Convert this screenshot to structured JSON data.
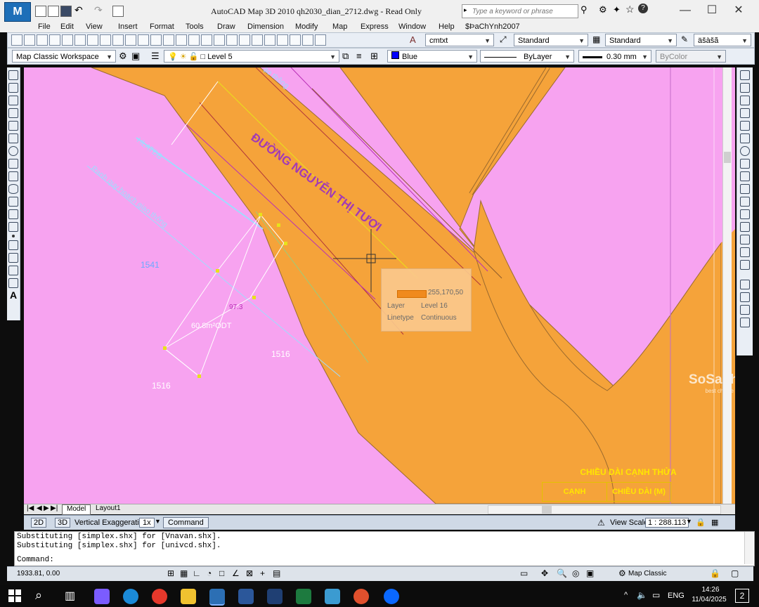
{
  "app": {
    "title": "AutoCAD Map 3D 2010       qh2030_dian_2712.dwg - Read Only",
    "search_placeholder": "Type a keyword or phrase",
    "logo_text": "M",
    "window_controls": [
      "—",
      "☐",
      "✕"
    ]
  },
  "menu": {
    "items": [
      "File",
      "Edit",
      "View",
      "Insert",
      "Format",
      "Tools",
      "Draw",
      "Dimension",
      "Modify",
      "Map",
      "Express",
      "Window",
      "Help",
      "$ÞaChYnh2007"
    ]
  },
  "toolbar2": {
    "text_style": "cmtxt",
    "dim_style": "Standard",
    "table_style": "Standard",
    "extra": "äšàšã"
  },
  "toolbar3": {
    "workspace": "Map Classic Workspace",
    "layer": "Level 5",
    "color": "Blue",
    "linetype": "ByLayer",
    "lineweight": "0.30 mm",
    "plotstyle": "ByColor"
  },
  "drawing": {
    "road_name": "ĐƯỜNG NGUYỄN THỊ TƯƠI",
    "label_hlat": "HLATĐB",
    "label_ranh": "Ranh quy hoạch giao thông",
    "label_top": "ạo thông",
    "parcel_1541": "1541",
    "parcel_1516a": "1516",
    "parcel_1516b": "1516",
    "area_label": "60.8m²ODT",
    "dim_97": "97.3",
    "legend_title": "CHIỀU DÀI CẠNH THỬA",
    "legend_col1": "CẠNH",
    "legend_col2": "CHIỀU DÀI (M)",
    "watermark_main": "SoSanhnhà",
    "watermark_sub": "best choice",
    "colors": {
      "background": "#f7a3f0",
      "road": "#f5a33a",
      "line_red": "#b0363a",
      "line_magenta": "#b92fb6",
      "line_cyan": "#9fdcff",
      "line_yellow": "#e8e21a",
      "line_green": "#9ccc7a"
    }
  },
  "tooltip": {
    "coord": "255,170,50",
    "layer_key": "Layer",
    "layer_val": "Level 16",
    "linetype_key": "Linetype",
    "linetype_val": "Continuous"
  },
  "tabs": [
    "Model",
    "Layout1"
  ],
  "status1": {
    "mode_2d": "2D",
    "mode_3d": "3D",
    "vert_exag_label": "Vertical Exaggeration:",
    "vert_exag_value": "1x",
    "command_button": "Command",
    "view_scale_label": "View Scale",
    "view_scale_value": "1 : 288.113"
  },
  "command": {
    "line1": "Substituting [simplex.shx] for [Vnavan.shx].",
    "line2": "Substituting [simplex.shx] for [univcd.shx].",
    "prompt": "Command:"
  },
  "status2": {
    "coords": "1933.81, 0.00",
    "workspace": "Map Classic"
  },
  "taskbar": {
    "language": "ENG",
    "time": "14:26",
    "date": "11/04/2025",
    "notification_count": "2"
  }
}
